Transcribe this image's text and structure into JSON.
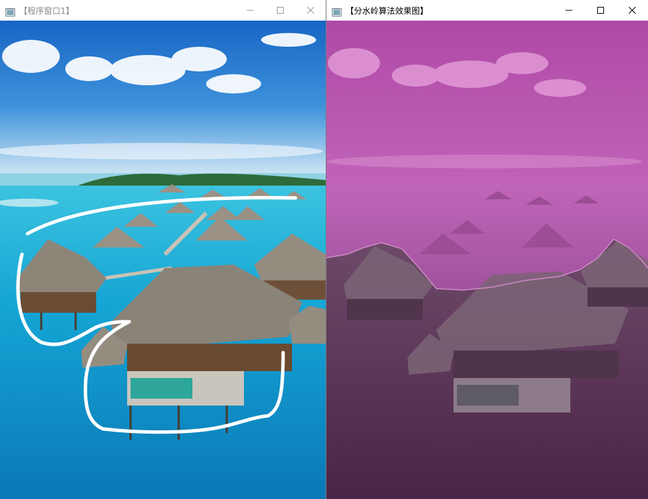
{
  "window1": {
    "title": "【程序窗口1】",
    "icons": [
      "app-icon",
      "minimize-icon",
      "maximize-icon",
      "close-icon"
    ]
  },
  "window2": {
    "title": "【分水岭算法效果图】",
    "icons": [
      "app-icon",
      "minimize-icon",
      "maximize-icon",
      "close-icon"
    ]
  },
  "colors": {
    "sky_top": "#1a6fd0",
    "sky_bottom": "#cfe6f5",
    "lagoon": "#15a7d6",
    "lagoon_deep": "#0a6fa8",
    "thatch": "#8a8378",
    "stroke_marker": "#ffffff",
    "magenta_region": "#c060b8",
    "purple_region": "#6a2a6a"
  }
}
